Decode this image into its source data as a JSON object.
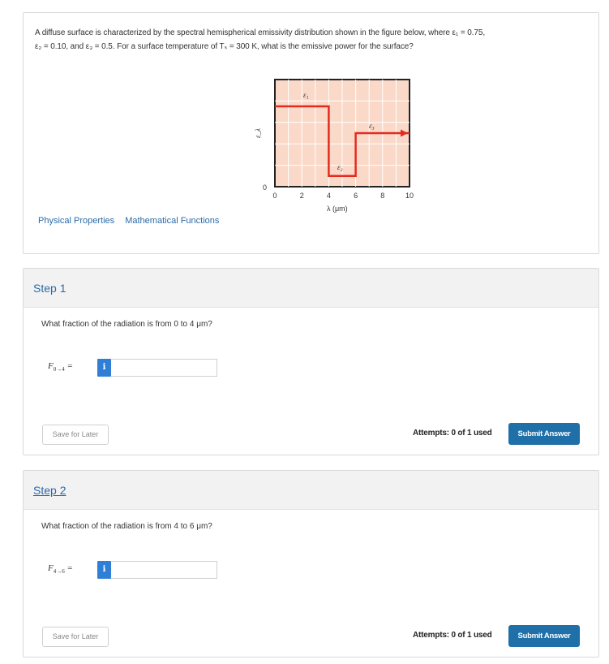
{
  "problem": {
    "question_line1": "A diffuse surface is characterized by the spectral hemispherical emissivity distribution shown in the figure below, where ε₁ = 0.75,",
    "question_line2": "ε₂ = 0.10, and ε₃ = 0.5. For a surface temperature of Tₛ = 300 K, what is the emissive power for the surface?",
    "links": [
      "Physical Properties",
      "Mathematical Functions"
    ]
  },
  "figure": {
    "y_axis_label": "ε_λ",
    "y_zero_label": "0",
    "x_axis_label": "λ (μm)",
    "x_ticks": [
      "0",
      "2",
      "4",
      "6",
      "8",
      "10"
    ],
    "region_labels": [
      "ε₁",
      "ε₂",
      "ε₃"
    ],
    "colors": {
      "background": "#fbd9c9",
      "grid": "#ffffff",
      "line": "#e32b1e",
      "frame": "#222222"
    }
  },
  "chart_data": {
    "type": "line",
    "x": [
      0,
      4,
      4,
      6,
      6,
      10
    ],
    "y": [
      0.75,
      0.75,
      0.1,
      0.1,
      0.5,
      0.5
    ],
    "xlabel": "λ (μm)",
    "ylabel": "ε_λ",
    "xlim": [
      0,
      10
    ],
    "ylim": [
      0,
      1
    ],
    "grid": true
  },
  "steps": [
    {
      "title": "Step 1",
      "question": "What fraction of the radiation is from 0 to 4 μm?",
      "variable": "F",
      "variable_sub": "0→4",
      "equals": "=",
      "info_icon": "i",
      "input_value": "",
      "save_label": "Save for Later",
      "attempts": "Attempts: 0 of 1 used",
      "submit_label": "Submit Answer"
    },
    {
      "title": "Step 2",
      "question": "What fraction of the radiation is from 4 to 6 μm?",
      "variable": "F",
      "variable_sub": "4→6",
      "equals": "=",
      "info_icon": "i",
      "input_value": "",
      "save_label": "Save for Later",
      "attempts": "Attempts: 0 of 1 used",
      "submit_label": "Submit Answer"
    }
  ]
}
